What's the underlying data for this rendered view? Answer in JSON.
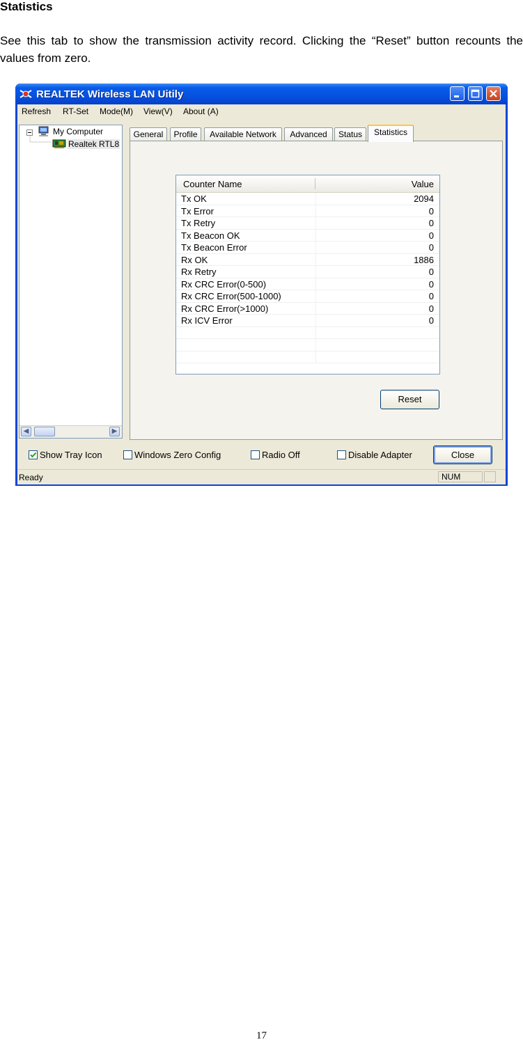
{
  "doc": {
    "heading": "Statistics",
    "paragraph": "See this tab to show the transmission activity record. Clicking the “Reset” button recounts the values from zero.",
    "page_number": "17"
  },
  "window": {
    "title": "REALTEK Wireless LAN Uitily",
    "menu": [
      "Refresh",
      "RT-Set",
      "Mode(M)",
      "View(V)",
      "About (A)"
    ],
    "tree": {
      "root": "My Computer",
      "child": "Realtek RTL8"
    },
    "tabs": [
      "General",
      "Profile",
      "Available Network",
      "Advanced",
      "Status",
      "Statistics"
    ],
    "active_tab": "Statistics",
    "table": {
      "headers": {
        "name": "Counter Name",
        "value": "Value"
      },
      "rows": [
        {
          "name": "Tx OK",
          "value": "2094"
        },
        {
          "name": "Tx Error",
          "value": "0"
        },
        {
          "name": "Tx Retry",
          "value": "0"
        },
        {
          "name": "Tx Beacon OK",
          "value": "0"
        },
        {
          "name": "Tx Beacon Error",
          "value": "0"
        },
        {
          "name": "Rx OK",
          "value": "1886"
        },
        {
          "name": "Rx Retry",
          "value": "0"
        },
        {
          "name": "Rx CRC Error(0-500)",
          "value": "0"
        },
        {
          "name": "Rx CRC Error(500-1000)",
          "value": "0"
        },
        {
          "name": "Rx CRC Error(>1000)",
          "value": "0"
        },
        {
          "name": "Rx ICV Error",
          "value": "0"
        }
      ]
    },
    "reset_label": "Reset",
    "checkboxes": [
      {
        "label": "Show Tray Icon",
        "checked": true
      },
      {
        "label": "Windows Zero Config",
        "checked": false
      },
      {
        "label": "Radio Off",
        "checked": false
      },
      {
        "label": "Disable Adapter",
        "checked": false
      }
    ],
    "close_label": "Close",
    "status": {
      "text": "Ready",
      "num": "NUM"
    }
  }
}
